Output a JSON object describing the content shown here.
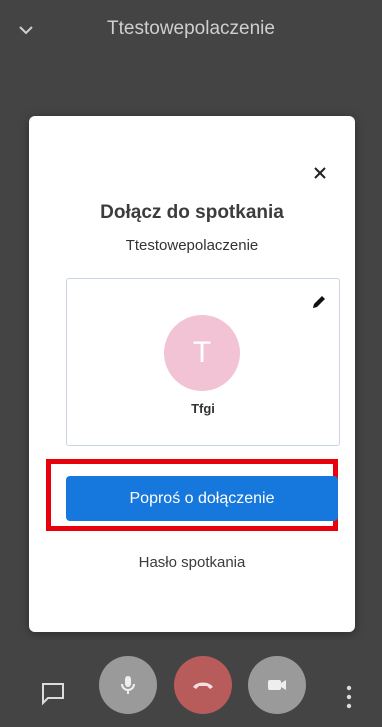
{
  "header": {
    "title": "Ttestowepolaczenie",
    "collapse_icon": "chevron-down-icon"
  },
  "modal": {
    "title": "Dołącz do spotkania",
    "subtitle": "Ttestowepolaczenie",
    "close_icon": "close-icon",
    "profile": {
      "avatar_letter": "T",
      "avatar_color": "#f2c3d4",
      "name": "Tfgi",
      "edit_icon": "pencil-icon"
    },
    "join_button_label": "Poproś o dołączenie",
    "join_button_color": "#1678dc",
    "highlight_color": "#e8000b",
    "password_link": "Hasło spotkania"
  },
  "controls": {
    "chat_icon": "chat-icon",
    "mic_icon": "microphone-icon",
    "hangup_icon": "hangup-icon",
    "hangup_color": "#b85b5b",
    "camera_icon": "camera-icon",
    "more_icon": "more-vertical-icon"
  }
}
